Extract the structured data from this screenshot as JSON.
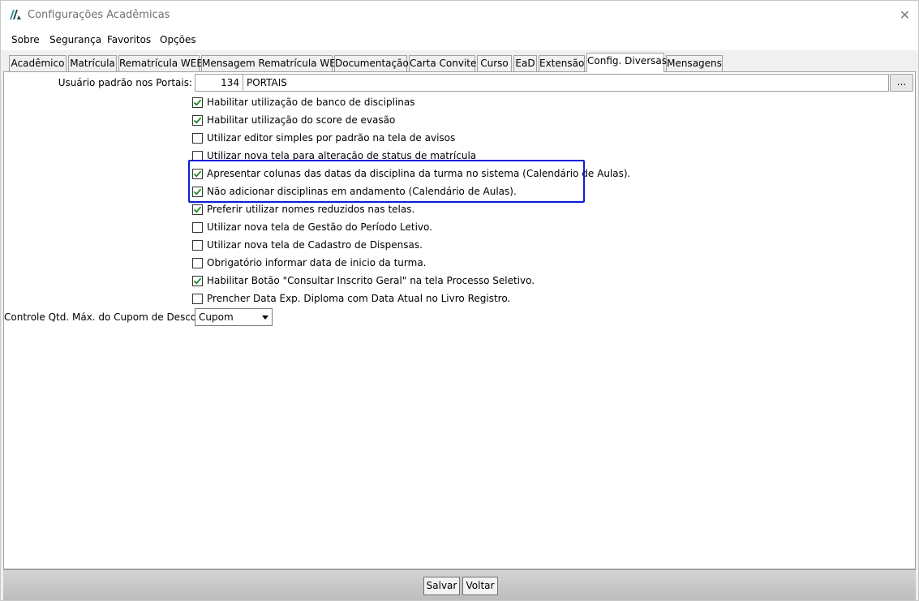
{
  "window": {
    "title": "Configurações Acadêmicas",
    "close_glyph": "✕"
  },
  "menu": [
    {
      "label": "Sobre"
    },
    {
      "label": "Segurança"
    },
    {
      "label": "Favoritos"
    },
    {
      "label": "Opções"
    }
  ],
  "tabs": [
    {
      "label": "Acadêmico",
      "active": false
    },
    {
      "label": "Matrícula",
      "active": false
    },
    {
      "label": "Rematrícula WEB",
      "active": false
    },
    {
      "label": "Mensagem Rematrícula WEB",
      "active": false
    },
    {
      "label": "Documentação",
      "active": false
    },
    {
      "label": "Carta Convite",
      "active": false
    },
    {
      "label": "Curso",
      "active": false
    },
    {
      "label": "EaD",
      "active": false
    },
    {
      "label": "Extensão",
      "active": false
    },
    {
      "label": "Config. Diversas",
      "active": true
    },
    {
      "label": "Mensagens",
      "active": false
    }
  ],
  "portal_user": {
    "label": "Usuário padrão nos Portais:",
    "code": "134",
    "name": "PORTAIS",
    "browse_label": "..."
  },
  "options": [
    {
      "label": "Habilitar utilização de banco de disciplinas",
      "checked": true
    },
    {
      "label": "Habilitar utilização do score de evasão",
      "checked": true
    },
    {
      "label": "Utilizar editor simples por padrão na tela de avisos",
      "checked": false
    },
    {
      "label": "Utilizar nova tela para alteração de status de matrícula",
      "checked": false
    },
    {
      "label": "Apresentar colunas das datas da disciplina da turma no sistema (Calendário de Aulas).",
      "checked": true
    },
    {
      "label": "Não adicionar disciplinas em andamento (Calendário de Aulas).",
      "checked": true
    },
    {
      "label": "Preferir utilizar nomes reduzidos nas telas.",
      "checked": true
    },
    {
      "label": "Utilizar nova tela de Gestão do Período Letivo.",
      "checked": false
    },
    {
      "label": "Utilizar nova tela de Cadastro de Dispensas.",
      "checked": false
    },
    {
      "label": "Obrigatório informar data de inicio da turma.",
      "checked": false
    },
    {
      "label": "Habilitar Botão \"Consultar Inscrito Geral\" na tela Processo Seletivo.",
      "checked": true
    },
    {
      "label": "Prencher Data Exp. Diploma com Data Atual no Livro Registro.",
      "checked": false
    }
  ],
  "coupon_control": {
    "label": "Controle Qtd. Máx. do Cupom de Desconto",
    "selected": "Cupom"
  },
  "footer": {
    "save_label": "Salvar",
    "back_label": "Voltar"
  },
  "colors": {
    "highlight_border": "#0a1fd6",
    "check_mark": "#1a8a1a"
  }
}
